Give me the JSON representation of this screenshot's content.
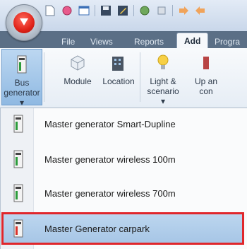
{
  "ribbon_tabs": [
    "File",
    "Views",
    "Reports",
    "Add",
    "Progra"
  ],
  "ribbon_buttons": {
    "bus_generator": {
      "line1": "Bus",
      "line2": "generator ▾"
    },
    "module": {
      "line1": "Module"
    },
    "location": {
      "line1": "Location"
    },
    "light_scenario": {
      "line1": "Light &",
      "line2": "scenario ▾"
    },
    "up_an": {
      "line1": "Up an",
      "line2": "con"
    }
  },
  "dropdown_items": [
    {
      "label": "Master generator Smart-Dupline"
    },
    {
      "label": "Master generator wireless 100m"
    },
    {
      "label": "Master generator wireless 700m"
    },
    {
      "label": "Master Generator carpark"
    }
  ],
  "colors": {
    "highlight_outline": "#e0262b",
    "accent_red": "#e02318"
  }
}
